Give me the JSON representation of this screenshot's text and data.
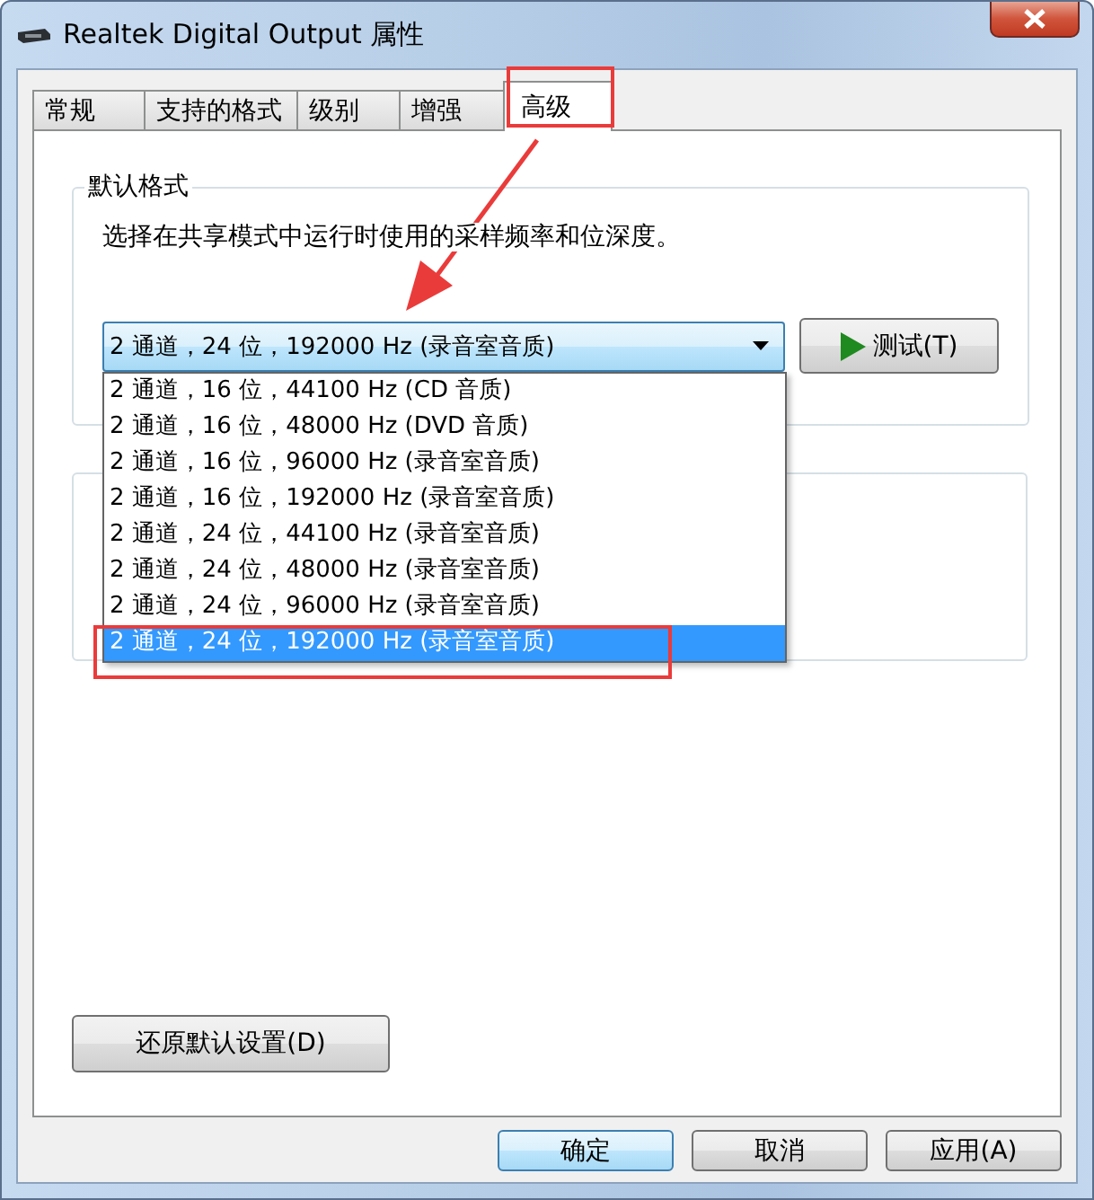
{
  "window": {
    "title": "Realtek Digital Output 属性"
  },
  "tabs": [
    {
      "label": "常规",
      "selected": false
    },
    {
      "label": "支持的格式",
      "selected": false
    },
    {
      "label": "级别",
      "selected": false
    },
    {
      "label": "增强",
      "selected": false
    },
    {
      "label": "高级",
      "selected": true
    }
  ],
  "default_format": {
    "title": "默认格式",
    "description": "选择在共享模式中运行时使用的采样频率和位深度。",
    "dropdown": {
      "value": "2 通道，24 位，192000 Hz (录音室音质)",
      "expanded": true,
      "options": [
        {
          "label": "2 通道，16 位，44100 Hz (CD 音质)",
          "selected": false
        },
        {
          "label": "2 通道，16 位，48000 Hz (DVD 音质)",
          "selected": false
        },
        {
          "label": "2 通道，16 位，96000 Hz (录音室音质)",
          "selected": false
        },
        {
          "label": "2 通道，16 位，192000 Hz (录音室音质)",
          "selected": false
        },
        {
          "label": "2 通道，24 位，44100 Hz (录音室音质)",
          "selected": false
        },
        {
          "label": "2 通道，24 位，48000 Hz (录音室音质)",
          "selected": false
        },
        {
          "label": "2 通道，24 位，96000 Hz (录音室音质)",
          "selected": false
        },
        {
          "label": "2 通道，24 位，192000 Hz (录音室音质)",
          "selected": true
        }
      ]
    },
    "test_button": "测试(T)"
  },
  "exclusive_mode": {
    "kind": "group"
  },
  "restore_button": "还原默认设置(D)",
  "buttons": [
    {
      "label": "确定",
      "default": true
    },
    {
      "label": "取消",
      "default": false
    },
    {
      "label": "应用(A)",
      "default": false
    }
  ]
}
